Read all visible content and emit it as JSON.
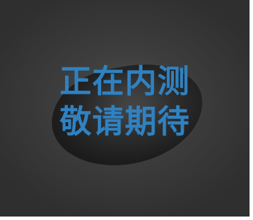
{
  "message": {
    "line1": "正在内测",
    "line2": "敬请期待"
  },
  "colors": {
    "text": "#2f82c2",
    "background": "#3d3d3d",
    "border": "#ffffff"
  }
}
